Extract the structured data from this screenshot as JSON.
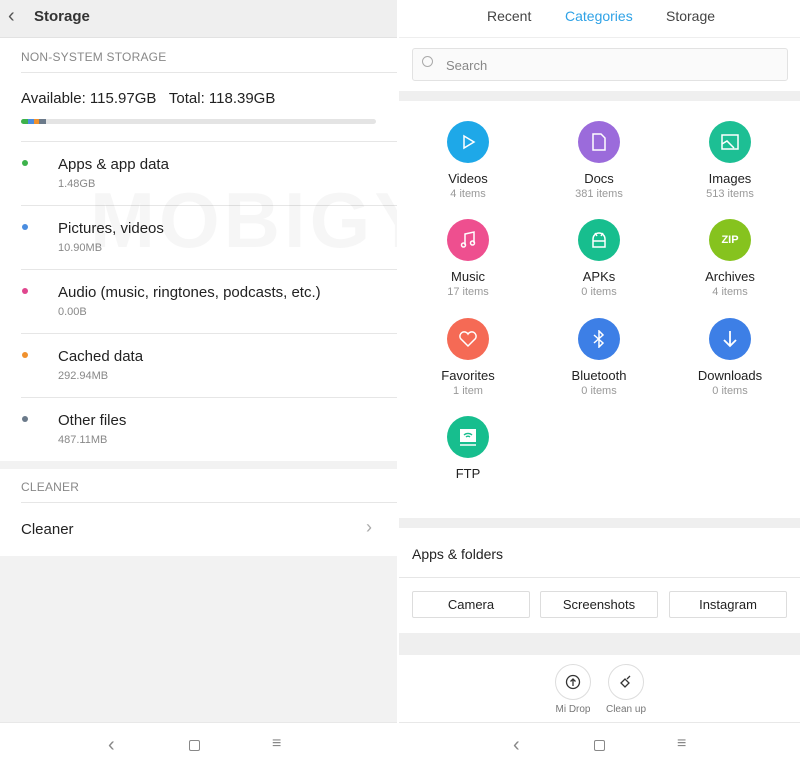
{
  "watermark": "MOBIGYAAN",
  "left": {
    "title": "Storage",
    "section_storage": "NON-SYSTEM STORAGE",
    "available": "Available: 115.97GB",
    "total": "Total: 118.39GB",
    "items": [
      {
        "name": "Apps & app data",
        "size": "1.48GB",
        "color": "#3db24b"
      },
      {
        "name": "Pictures, videos",
        "size": "10.90MB",
        "color": "#4a8de0"
      },
      {
        "name": "Audio (music, ringtones, podcasts, etc.)",
        "size": "0.00B",
        "color": "#e0468e"
      },
      {
        "name": "Cached data",
        "size": "292.94MB",
        "color": "#f0912e"
      },
      {
        "name": "Other files",
        "size": "487.11MB",
        "color": "#6b7a8a"
      }
    ],
    "section_cleaner": "CLEANER",
    "cleaner_label": "Cleaner"
  },
  "right": {
    "tabs": [
      "Recent",
      "Categories",
      "Storage"
    ],
    "active_tab": "Categories",
    "accent": "#2fa2e6",
    "search_placeholder": "Search",
    "categories": [
      {
        "name": "Videos",
        "count": "4 items",
        "color": "#1ea8e8",
        "icon": "play-icon"
      },
      {
        "name": "Docs",
        "count": "381 items",
        "color": "#9b6bdb",
        "icon": "document-icon"
      },
      {
        "name": "Images",
        "count": "513 items",
        "color": "#1dbf94",
        "icon": "image-icon"
      },
      {
        "name": "Music",
        "count": "17 items",
        "color": "#ee4f8f",
        "icon": "music-icon"
      },
      {
        "name": "APKs",
        "count": "0 items",
        "color": "#17be8e",
        "icon": "android-icon"
      },
      {
        "name": "Archives",
        "count": "4 items",
        "color": "#86c31e",
        "icon": "zip-icon",
        "icon_text": "ZIP"
      },
      {
        "name": "Favorites",
        "count": "1 item",
        "color": "#f56a55",
        "icon": "heart-icon"
      },
      {
        "name": "Bluetooth",
        "count": "0 items",
        "color": "#3d7fe6",
        "icon": "bluetooth-icon"
      },
      {
        "name": "Downloads",
        "count": "0 items",
        "color": "#3d7fe6",
        "icon": "download-icon"
      },
      {
        "name": "FTP",
        "count": "",
        "color": "#17be8e",
        "icon": "ftp-icon"
      }
    ],
    "apps_folders_title": "Apps & folders",
    "folders": [
      "Camera",
      "Screenshots",
      "Instagram"
    ],
    "actions": [
      {
        "label": "Mi Drop",
        "icon": "upload-icon"
      },
      {
        "label": "Clean up",
        "icon": "broom-icon"
      }
    ]
  }
}
